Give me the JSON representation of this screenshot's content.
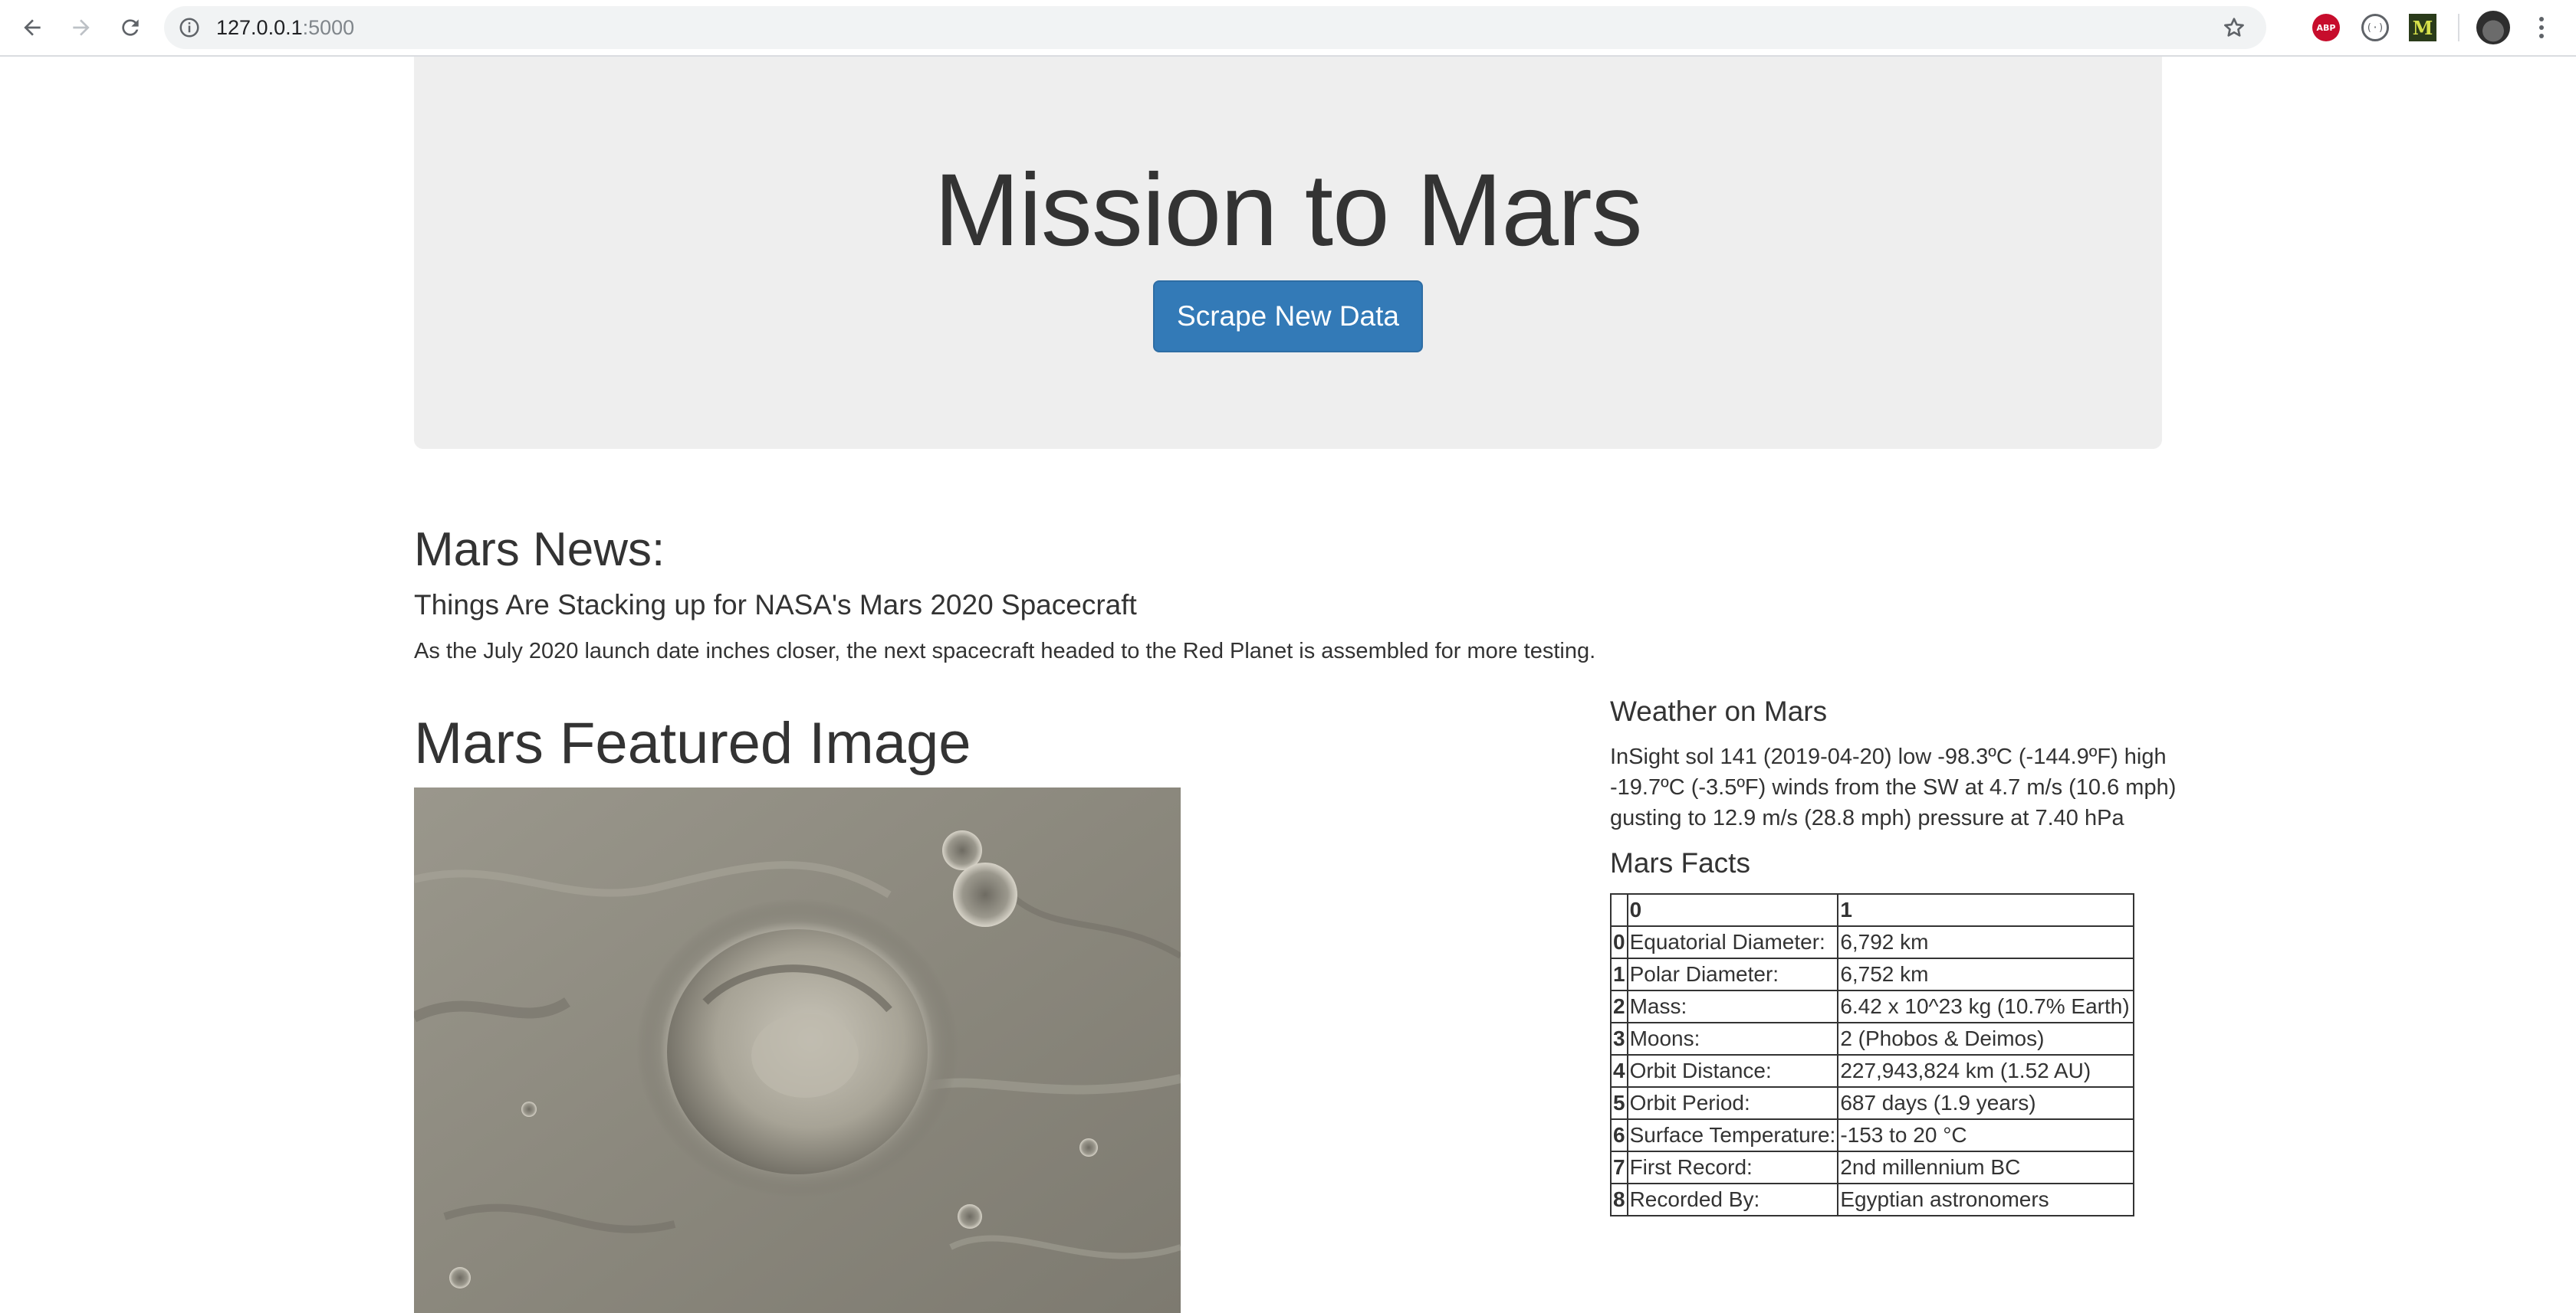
{
  "browser": {
    "url_host": "127.0.0.1",
    "url_port": ":5000",
    "extensions": {
      "adblock_label": "ABP",
      "reader_label": "(·)",
      "m_label": "M"
    }
  },
  "header": {
    "title": "Mission to Mars",
    "scrape_button_label": "Scrape New Data"
  },
  "news": {
    "heading": "Mars News:",
    "title": "Things Are Stacking up for NASA's Mars 2020 Spacecraft",
    "teaser": "As the July 2020 launch date inches closer, the next spacecraft headed to the Red Planet is assembled for more testing."
  },
  "featured": {
    "heading": "Mars Featured Image"
  },
  "weather": {
    "heading": "Weather on Mars",
    "text": "InSight sol 141 (2019-04-20) low -98.3ºC (-144.9ºF) high -19.7ºC (-3.5ºF) winds from the SW at 4.7 m/s (10.6 mph) gusting to 12.9 m/s (28.8 mph) pressure at 7.40 hPa"
  },
  "facts": {
    "heading": "Mars Facts",
    "columns": [
      "",
      "0",
      "1"
    ],
    "rows": [
      {
        "idx": "0",
        "key": "Equatorial Diameter:",
        "val": "6,792 km"
      },
      {
        "idx": "1",
        "key": "Polar Diameter:",
        "val": "6,752 km"
      },
      {
        "idx": "2",
        "key": "Mass:",
        "val": "6.42 x 10^23 kg (10.7% Earth)"
      },
      {
        "idx": "3",
        "key": "Moons:",
        "val": "2 (Phobos & Deimos)"
      },
      {
        "idx": "4",
        "key": "Orbit Distance:",
        "val": "227,943,824 km (1.52 AU)"
      },
      {
        "idx": "5",
        "key": "Orbit Period:",
        "val": "687 days (1.9 years)"
      },
      {
        "idx": "6",
        "key": "Surface Temperature:",
        "val": "-153 to 20 °C"
      },
      {
        "idx": "7",
        "key": "First Record:",
        "val": "2nd millennium BC"
      },
      {
        "idx": "8",
        "key": "Recorded By:",
        "val": "Egyptian astronomers"
      }
    ]
  },
  "colors": {
    "jumbotron_bg": "#eeeeee",
    "button_primary": "#337ab7",
    "text": "#333333"
  }
}
